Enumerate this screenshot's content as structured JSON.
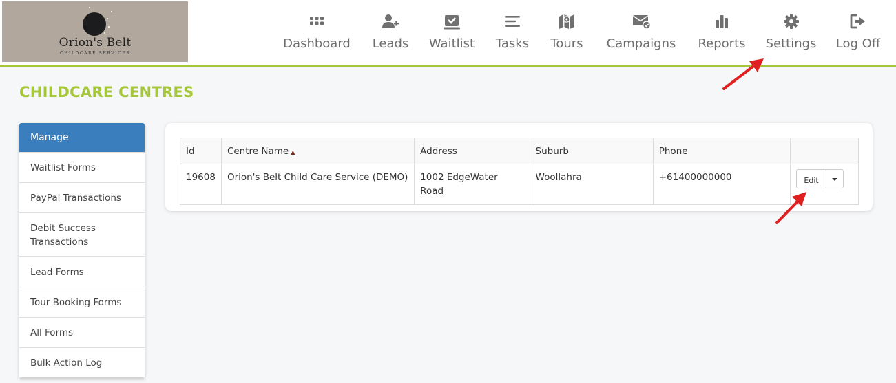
{
  "logo": {
    "brand": "Orion's Belt",
    "tagline": "CHILDCARE SERVICES"
  },
  "nav": [
    {
      "label": "Dashboard",
      "icon": "dashboard-grid-icon"
    },
    {
      "label": "Leads",
      "icon": "add-user-icon"
    },
    {
      "label": "Waitlist",
      "icon": "clipboard-check-icon"
    },
    {
      "label": "Tasks",
      "icon": "tasks-list-icon"
    },
    {
      "label": "Tours",
      "icon": "map-icon"
    },
    {
      "label": "Campaigns",
      "icon": "envelope-check-icon"
    },
    {
      "label": "Reports",
      "icon": "bar-chart-icon"
    },
    {
      "label": "Settings",
      "icon": "gear-icon"
    },
    {
      "label": "Log Off",
      "icon": "log-off-icon"
    }
  ],
  "page": {
    "title": "CHILDCARE CENTRES"
  },
  "sidebar": {
    "header": "Manage",
    "items": [
      {
        "label": "Waitlist Forms"
      },
      {
        "label": "PayPal Transactions"
      },
      {
        "label": "Debit Success Transactions"
      },
      {
        "label": "Lead Forms"
      },
      {
        "label": "Tour Booking Forms"
      },
      {
        "label": "All Forms"
      },
      {
        "label": "Bulk Action Log"
      }
    ]
  },
  "table": {
    "columns": [
      "Id",
      "Centre Name",
      "Address",
      "Suburb",
      "Phone",
      ""
    ],
    "sort_column": "Centre Name",
    "sort_direction": "ascending",
    "rows": [
      {
        "id": "19608",
        "centre_name": "Orion's Belt Child Care Service (DEMO)",
        "address": "1002 EdgeWater Road",
        "suburb": "Woollahra",
        "phone": "+61400000000",
        "action_label": "Edit"
      }
    ]
  },
  "colors": {
    "accent": "#a7c73a",
    "primary": "#3a7ebd",
    "annotation": "#e02020",
    "logo_bg": "#b1a79d"
  }
}
